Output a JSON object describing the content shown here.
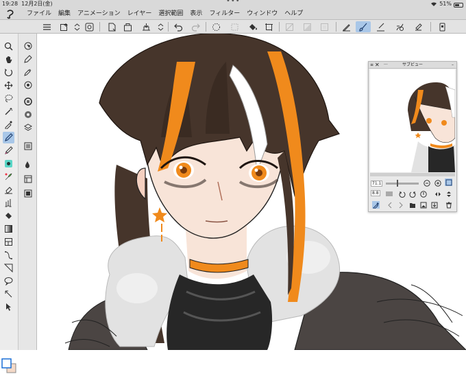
{
  "status": {
    "time": "19:28",
    "date": "12月2日(金)",
    "dots": "•••",
    "battery": "51%"
  },
  "menu": [
    "ファイル",
    "編集",
    "アニメーション",
    "レイヤー",
    "選択範囲",
    "表示",
    "フィルター",
    "ウィンドウ",
    "ヘルプ"
  ],
  "subview": {
    "title": "サブビュー",
    "zoom": "71.1",
    "rotation": "8.8"
  },
  "colors": {
    "chrome": "#d9d9d9",
    "selected": "#a9c7e8",
    "hair": "#46352b",
    "orange": "#f08a1c",
    "skin": "#f8e4d8",
    "fur": "#dcdcdc",
    "dark": "#272727"
  },
  "tools_left": [
    "menu-icon",
    "zoom-icon",
    "hand-icon",
    "rotate-icon",
    "move-icon",
    "lasso-icon",
    "magic-wand-icon",
    "eyedropper-icon",
    "pen-icon",
    "pencil-icon",
    "brush-icon",
    "airbrush-icon",
    "decoration-icon",
    "eraser-icon",
    "blend-icon",
    "fill-icon",
    "gradient-icon",
    "figure-icon",
    "frame-icon",
    "operation-icon",
    "balloon-icon",
    "line-icon",
    "text-icon"
  ],
  "tools_right": [
    "navigator-icon",
    "sub-tool-icon",
    "tool-property-icon",
    "brush-size-icon",
    "color-circle-icon",
    "color-set-icon",
    "layer-icon",
    "layer-property-icon",
    "material-icon",
    "history-icon",
    "color-slider-icon",
    "intermediate-color-icon",
    "approx-color-icon",
    "auto-action-icon",
    "item-bank-icon"
  ]
}
